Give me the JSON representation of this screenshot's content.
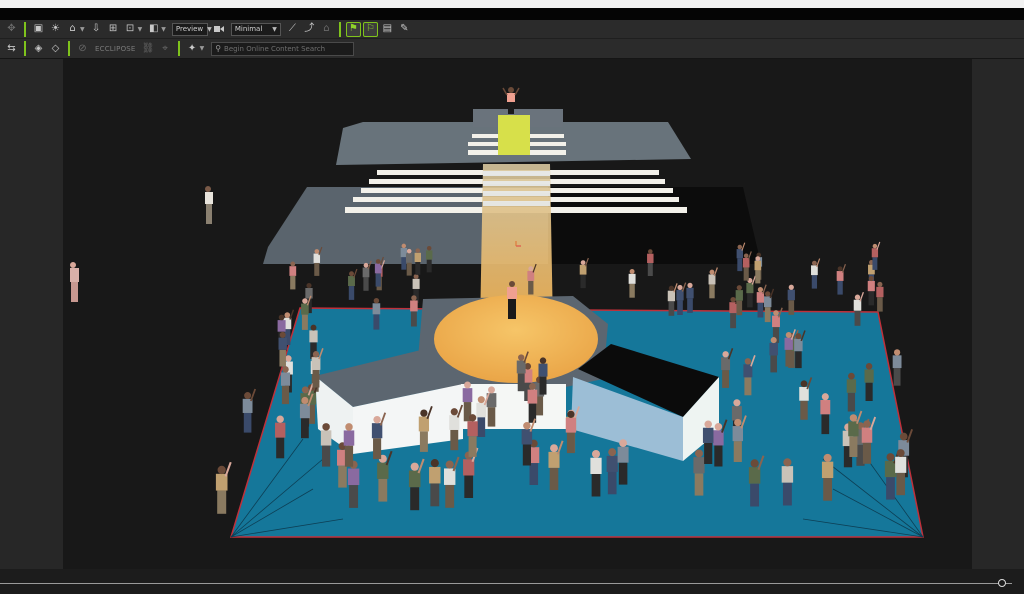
{
  "toolbar1": {
    "buttons": [
      {
        "icon": "move-icon",
        "glyph": "✥",
        "dim": true
      },
      {
        "sep": true
      },
      {
        "icon": "layout-icon",
        "glyph": "▣"
      },
      {
        "icon": "sun-icon",
        "glyph": "☀"
      },
      {
        "icon": "home-icon",
        "glyph": "⌂",
        "arrow": true
      },
      {
        "icon": "import-icon",
        "glyph": "⇩"
      },
      {
        "icon": "frame-all-icon",
        "glyph": "⊞"
      },
      {
        "icon": "frame-selected-icon",
        "glyph": "⊡",
        "arrow": true
      },
      {
        "icon": "render-quality-icon",
        "glyph": "◧",
        "arrow": true
      }
    ],
    "render_mode": {
      "value": "Preview"
    },
    "camera_icon": "camera-icon",
    "display_mode": {
      "value": "Minimal"
    },
    "buttons2": [
      {
        "icon": "bone-icon",
        "glyph": "⟋"
      },
      {
        "icon": "pose-icon",
        "glyph": "⤴"
      },
      {
        "icon": "lock-icon",
        "glyph": "⌂",
        "dim": true
      },
      {
        "sep": true
      },
      {
        "icon": "motion-path-icon",
        "glyph": "⚑",
        "active": true
      },
      {
        "icon": "flag-icon",
        "glyph": "⚐",
        "active": true
      },
      {
        "icon": "clipboard-icon",
        "glyph": "▤"
      },
      {
        "icon": "picker-icon",
        "glyph": "✎"
      }
    ]
  },
  "toolbar2": {
    "buttons": [
      {
        "icon": "transform-icon",
        "glyph": "⇆"
      },
      {
        "sep": true
      },
      {
        "icon": "target-icon",
        "glyph": "◈"
      },
      {
        "icon": "reset-icon",
        "glyph": "◇"
      },
      {
        "sep": true
      },
      {
        "icon": "eclipse-icon",
        "glyph": "⊘",
        "dim": true
      }
    ],
    "eclipse_label": "ECCLIPOSE",
    "buttons2": [
      {
        "icon": "link-icon",
        "glyph": "⛓",
        "dim": true
      },
      {
        "icon": "ik-icon",
        "glyph": "⌖",
        "dim": true
      },
      {
        "sep": true
      },
      {
        "icon": "plugin-icon",
        "glyph": "✦",
        "arrow": true
      }
    ],
    "search": {
      "placeholder": "Begin Online Content Search"
    }
  },
  "scene": {
    "description_icon": "3d-viewport",
    "colors": {
      "floor": "#15779a",
      "floor_edge": "#c0303a",
      "stage_top": "#5c6670",
      "spotlight": "#f0c060",
      "background": "#181818"
    },
    "crowd_count": 110
  },
  "timeline": {
    "progress": 0.99
  }
}
